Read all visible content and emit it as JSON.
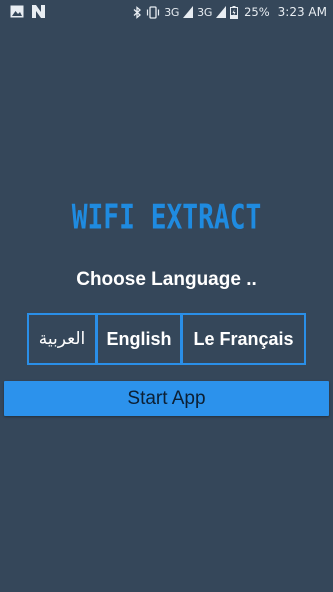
{
  "status_bar": {
    "network_type_1": "3G",
    "network_type_2": "3G",
    "battery_percent": "25%",
    "time": "3:23 AM",
    "icons": [
      "image-icon",
      "n-notification-icon",
      "bluetooth-icon",
      "vibrate-icon",
      "signal-icon",
      "signal-icon",
      "battery-charging-icon"
    ]
  },
  "app": {
    "title": "WIFI EXTRACT",
    "choose_language_label": "Choose Language ..",
    "languages": {
      "arabic": "العربية",
      "english": "English",
      "french": "Le Français"
    },
    "start_button_label": "Start App"
  },
  "colors": {
    "background": "#35475a",
    "accent": "#2c92ec",
    "title": "#1f8be0",
    "button_border": "#2a8fe8"
  }
}
